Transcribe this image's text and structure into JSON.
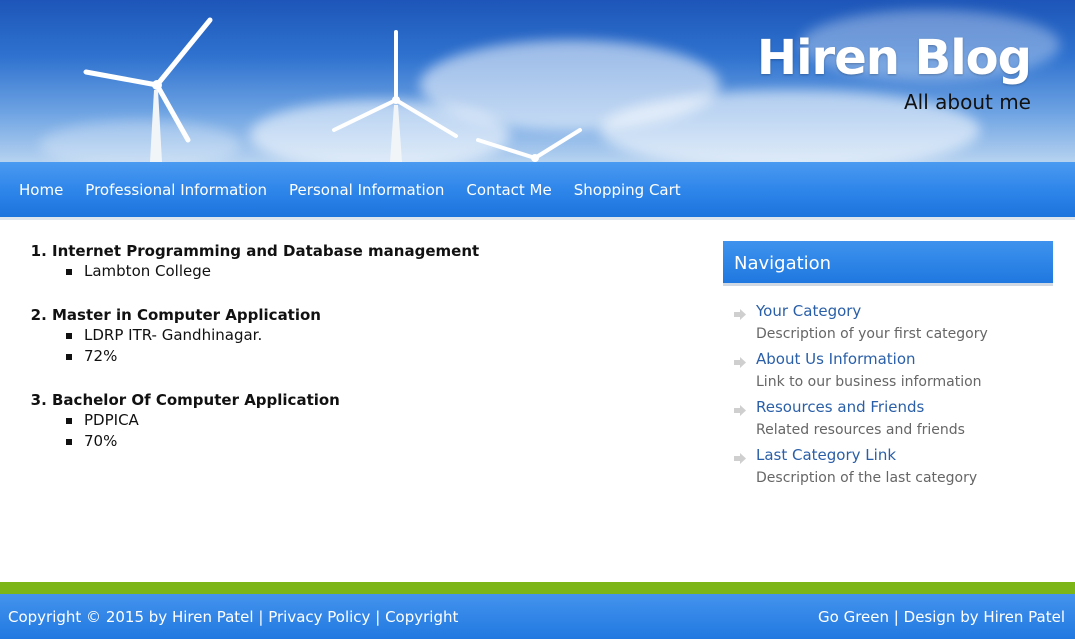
{
  "header": {
    "title": "Hiren Blog",
    "subtitle": "All about me"
  },
  "nav": {
    "items": [
      {
        "label": "Home"
      },
      {
        "label": "Professional Information"
      },
      {
        "label": "Personal Information"
      },
      {
        "label": "Contact Me"
      },
      {
        "label": "Shopping Cart"
      }
    ]
  },
  "education": [
    {
      "degree": "Internet Programming and Database management",
      "details": [
        "Lambton College"
      ]
    },
    {
      "degree": "Master in Computer Application",
      "details": [
        "LDRP ITR- Gandhinagar.",
        "72%"
      ]
    },
    {
      "degree": "Bachelor Of Computer Application",
      "details": [
        "PDPICA",
        "70%"
      ]
    }
  ],
  "sidebar": {
    "heading": "Navigation",
    "items": [
      {
        "link": "Your Category",
        "description": "Description of your first category"
      },
      {
        "link": "About Us Information",
        "description": "Link to our business information"
      },
      {
        "link": "Resources and Friends",
        "description": "Related resources and friends"
      },
      {
        "link": "Last Category Link",
        "description": "Description of the last category"
      }
    ]
  },
  "footer": {
    "copyright": "Copyright © 2015 by Hiren Patel",
    "separator": "|",
    "privacy": "Privacy Policy",
    "copyright_link": "Copyright",
    "go_green": "Go Green",
    "design_by": "Design by Hiren Patel"
  },
  "colors": {
    "nav_blue": "#2f86ea",
    "footer_green": "#7cb518",
    "link_blue": "#2a5fa8"
  }
}
